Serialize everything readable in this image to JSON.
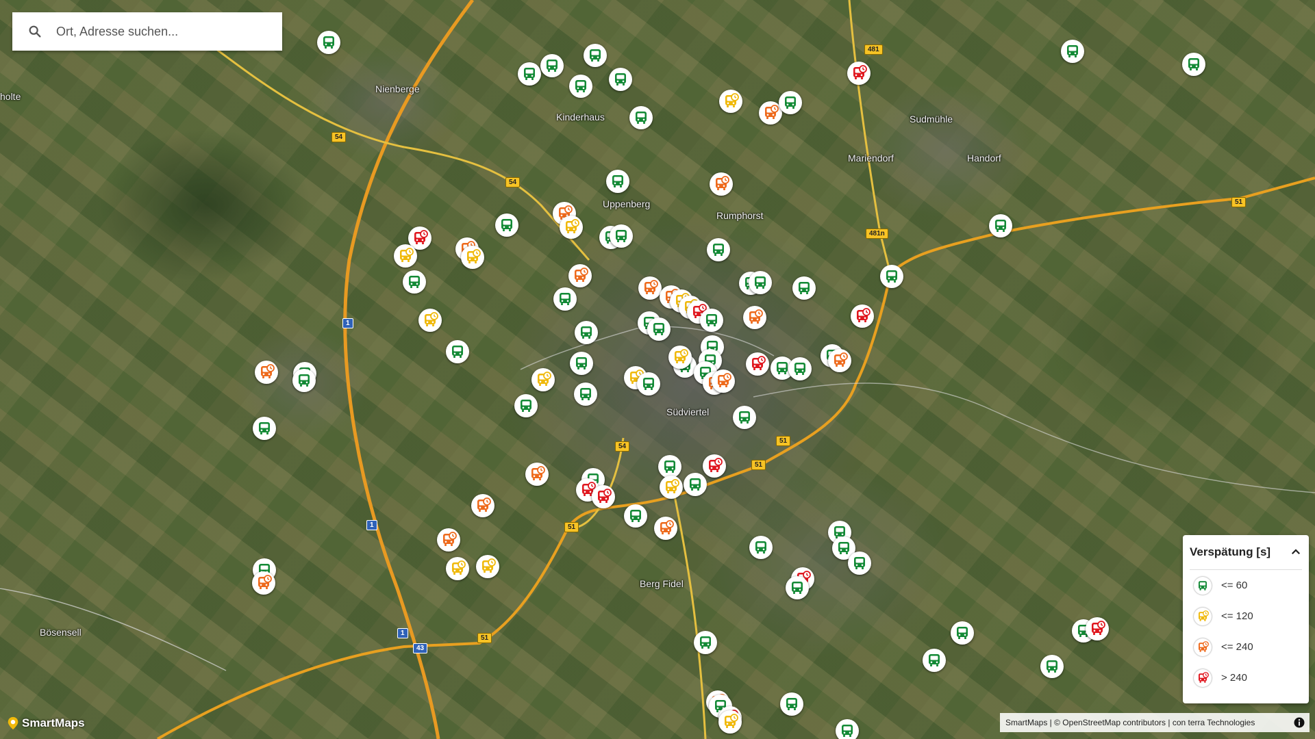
{
  "search": {
    "placeholder": "Ort, Adresse suchen..."
  },
  "places": [
    "Nienberge",
    "Kinderhaus",
    "Uppenberg",
    "Rumphorst",
    "Sudmühle",
    "Mariendorf",
    "Handorf",
    "Südviertel",
    "Berg Fidel",
    "Bösensell",
    "holte"
  ],
  "road_shields": [
    "54",
    "54",
    "481",
    "481n",
    "51",
    "51",
    "51",
    "51",
    "51",
    "54",
    "43",
    "1",
    "1",
    "1"
  ],
  "legend": {
    "title": "Verspätung [s]",
    "items": [
      {
        "label": "<= 60",
        "status": "green"
      },
      {
        "label": "<= 120",
        "status": "yellow"
      },
      {
        "label": "<= 240",
        "status": "orange"
      },
      {
        "label": "> 240",
        "status": "red"
      }
    ]
  },
  "colors": {
    "green": "#138a36",
    "yellow": "#f0b90b",
    "orange": "#ee6a1c",
    "red": "#e0171f"
  },
  "logo": {
    "text": "SmartMaps"
  },
  "attribution": "SmartMaps | © OpenStreetMap contributors | con terra Technologies",
  "icons": {
    "search": "search-icon",
    "chevron": "chevron-up-icon",
    "info": "info-icon",
    "bus": "bus-icon",
    "bus_delayed": "bus-clock-icon"
  }
}
